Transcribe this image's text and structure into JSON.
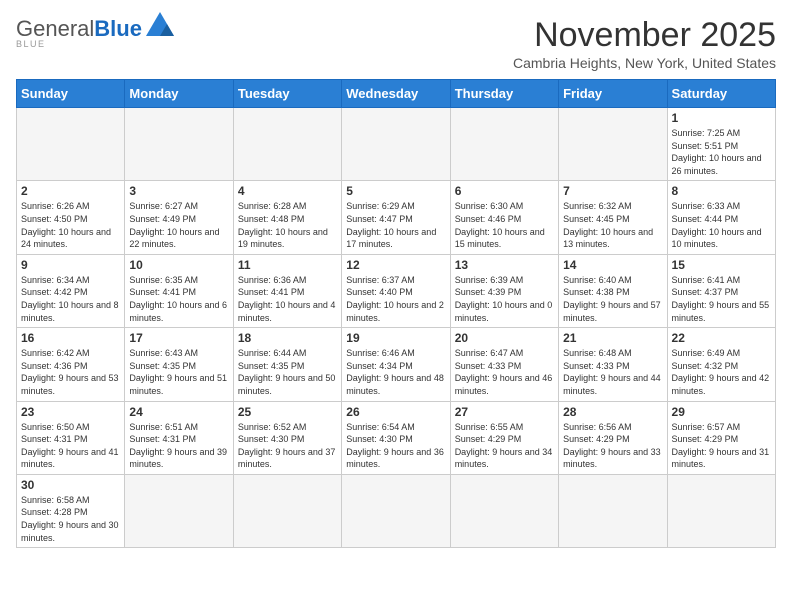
{
  "header": {
    "logo_general": "General",
    "logo_blue": "Blue",
    "month_title": "November 2025",
    "location": "Cambria Heights, New York, United States"
  },
  "weekdays": [
    "Sunday",
    "Monday",
    "Tuesday",
    "Wednesday",
    "Thursday",
    "Friday",
    "Saturday"
  ],
  "weeks": [
    [
      {
        "day": "",
        "info": ""
      },
      {
        "day": "",
        "info": ""
      },
      {
        "day": "",
        "info": ""
      },
      {
        "day": "",
        "info": ""
      },
      {
        "day": "",
        "info": ""
      },
      {
        "day": "",
        "info": ""
      },
      {
        "day": "1",
        "info": "Sunrise: 7:25 AM\nSunset: 5:51 PM\nDaylight: 10 hours and 26 minutes."
      }
    ],
    [
      {
        "day": "2",
        "info": "Sunrise: 6:26 AM\nSunset: 4:50 PM\nDaylight: 10 hours and 24 minutes."
      },
      {
        "day": "3",
        "info": "Sunrise: 6:27 AM\nSunset: 4:49 PM\nDaylight: 10 hours and 22 minutes."
      },
      {
        "day": "4",
        "info": "Sunrise: 6:28 AM\nSunset: 4:48 PM\nDaylight: 10 hours and 19 minutes."
      },
      {
        "day": "5",
        "info": "Sunrise: 6:29 AM\nSunset: 4:47 PM\nDaylight: 10 hours and 17 minutes."
      },
      {
        "day": "6",
        "info": "Sunrise: 6:30 AM\nSunset: 4:46 PM\nDaylight: 10 hours and 15 minutes."
      },
      {
        "day": "7",
        "info": "Sunrise: 6:32 AM\nSunset: 4:45 PM\nDaylight: 10 hours and 13 minutes."
      },
      {
        "day": "8",
        "info": "Sunrise: 6:33 AM\nSunset: 4:44 PM\nDaylight: 10 hours and 10 minutes."
      }
    ],
    [
      {
        "day": "9",
        "info": "Sunrise: 6:34 AM\nSunset: 4:42 PM\nDaylight: 10 hours and 8 minutes."
      },
      {
        "day": "10",
        "info": "Sunrise: 6:35 AM\nSunset: 4:41 PM\nDaylight: 10 hours and 6 minutes."
      },
      {
        "day": "11",
        "info": "Sunrise: 6:36 AM\nSunset: 4:41 PM\nDaylight: 10 hours and 4 minutes."
      },
      {
        "day": "12",
        "info": "Sunrise: 6:37 AM\nSunset: 4:40 PM\nDaylight: 10 hours and 2 minutes."
      },
      {
        "day": "13",
        "info": "Sunrise: 6:39 AM\nSunset: 4:39 PM\nDaylight: 10 hours and 0 minutes."
      },
      {
        "day": "14",
        "info": "Sunrise: 6:40 AM\nSunset: 4:38 PM\nDaylight: 9 hours and 57 minutes."
      },
      {
        "day": "15",
        "info": "Sunrise: 6:41 AM\nSunset: 4:37 PM\nDaylight: 9 hours and 55 minutes."
      }
    ],
    [
      {
        "day": "16",
        "info": "Sunrise: 6:42 AM\nSunset: 4:36 PM\nDaylight: 9 hours and 53 minutes."
      },
      {
        "day": "17",
        "info": "Sunrise: 6:43 AM\nSunset: 4:35 PM\nDaylight: 9 hours and 51 minutes."
      },
      {
        "day": "18",
        "info": "Sunrise: 6:44 AM\nSunset: 4:35 PM\nDaylight: 9 hours and 50 minutes."
      },
      {
        "day": "19",
        "info": "Sunrise: 6:46 AM\nSunset: 4:34 PM\nDaylight: 9 hours and 48 minutes."
      },
      {
        "day": "20",
        "info": "Sunrise: 6:47 AM\nSunset: 4:33 PM\nDaylight: 9 hours and 46 minutes."
      },
      {
        "day": "21",
        "info": "Sunrise: 6:48 AM\nSunset: 4:33 PM\nDaylight: 9 hours and 44 minutes."
      },
      {
        "day": "22",
        "info": "Sunrise: 6:49 AM\nSunset: 4:32 PM\nDaylight: 9 hours and 42 minutes."
      }
    ],
    [
      {
        "day": "23",
        "info": "Sunrise: 6:50 AM\nSunset: 4:31 PM\nDaylight: 9 hours and 41 minutes."
      },
      {
        "day": "24",
        "info": "Sunrise: 6:51 AM\nSunset: 4:31 PM\nDaylight: 9 hours and 39 minutes."
      },
      {
        "day": "25",
        "info": "Sunrise: 6:52 AM\nSunset: 4:30 PM\nDaylight: 9 hours and 37 minutes."
      },
      {
        "day": "26",
        "info": "Sunrise: 6:54 AM\nSunset: 4:30 PM\nDaylight: 9 hours and 36 minutes."
      },
      {
        "day": "27",
        "info": "Sunrise: 6:55 AM\nSunset: 4:29 PM\nDaylight: 9 hours and 34 minutes."
      },
      {
        "day": "28",
        "info": "Sunrise: 6:56 AM\nSunset: 4:29 PM\nDaylight: 9 hours and 33 minutes."
      },
      {
        "day": "29",
        "info": "Sunrise: 6:57 AM\nSunset: 4:29 PM\nDaylight: 9 hours and 31 minutes."
      }
    ],
    [
      {
        "day": "30",
        "info": "Sunrise: 6:58 AM\nSunset: 4:28 PM\nDaylight: 9 hours and 30 minutes."
      },
      {
        "day": "",
        "info": ""
      },
      {
        "day": "",
        "info": ""
      },
      {
        "day": "",
        "info": ""
      },
      {
        "day": "",
        "info": ""
      },
      {
        "day": "",
        "info": ""
      },
      {
        "day": "",
        "info": ""
      }
    ]
  ]
}
